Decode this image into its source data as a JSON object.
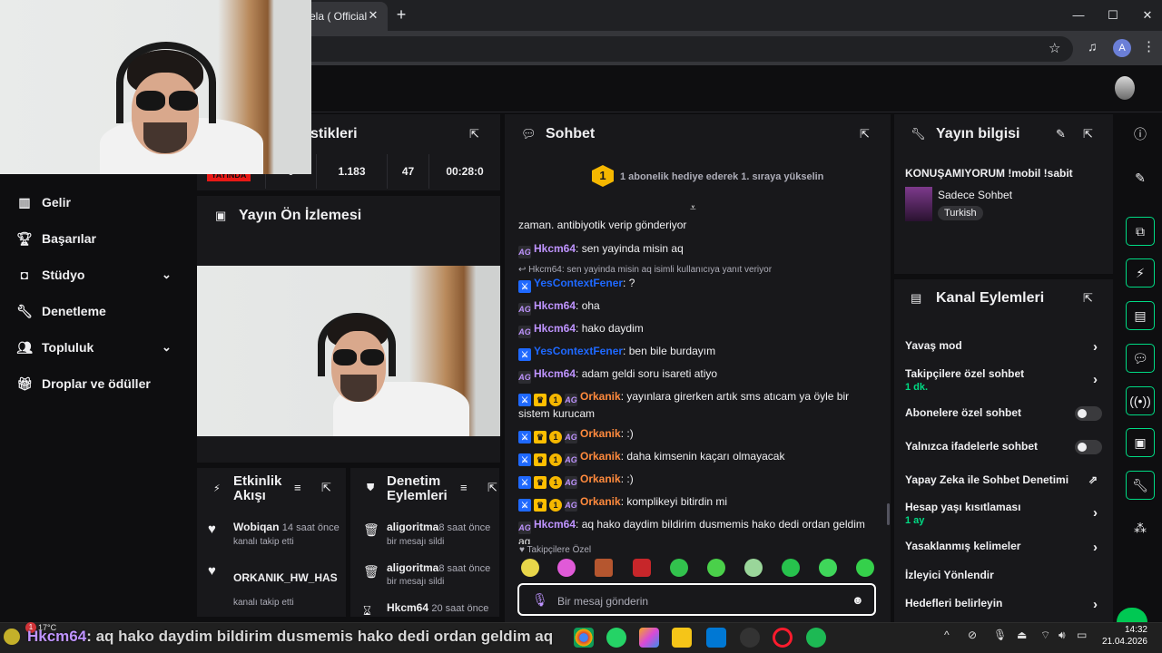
{
  "browser": {
    "tab_title": "ela ( Official",
    "new_tab": "+",
    "profile_initial": "A"
  },
  "nav": {
    "items": [
      {
        "label": "Gelir"
      },
      {
        "label": "Başarılar"
      },
      {
        "label": "Stüdyo"
      },
      {
        "label": "Denetleme"
      },
      {
        "label": "Topluluk"
      },
      {
        "label": "Droplar ve ödüller"
      }
    ]
  },
  "stats": {
    "title": "stikleri",
    "live_badge": "YAYINDA",
    "values": [
      "0",
      "1.183",
      "47",
      "00:28:0"
    ]
  },
  "preview": {
    "title": "Yayın Ön İzlemesi"
  },
  "activity": {
    "title": "Etkinlik Akışı",
    "events": [
      {
        "name": "Wobiqan",
        "time": "14 saat önce",
        "desc": "kanalı takip etti"
      },
      {
        "name": "ORKANIK_HW_HAS",
        "time": "",
        "desc": "kanalı takip etti"
      }
    ]
  },
  "modactions": {
    "title": "Denetim Eylemleri",
    "events": [
      {
        "name": "aligoritma",
        "time": "8 saat önce",
        "desc": "bir mesajı sildi"
      },
      {
        "name": "aligoritma",
        "time": "8 saat önce",
        "desc": "bir mesajı sildi"
      },
      {
        "name": "Hkcm64",
        "time": "20 saat önce",
        "desc": ""
      }
    ]
  },
  "chat": {
    "title": "Sohbet",
    "hype": {
      "rank": "1",
      "text": "1 abonelik hediye ederek 1. sıraya yükselin"
    },
    "messages": [
      {
        "user": "",
        "text": "zaman. antibiyotik verip gönderiyor"
      },
      {
        "user": "Hkcm64",
        "text": ": sen yayinda misin aq"
      },
      {
        "reply": "Hkcm64: sen yayinda misin aq isimli kullanıcıya yanıt veriyor"
      },
      {
        "user": "YesContextFener",
        "text": ": ?"
      },
      {
        "user": "Hkcm64",
        "text": ": oha"
      },
      {
        "user": "Hkcm64",
        "text": ": hako daydim"
      },
      {
        "user": "YesContextFener",
        "text": ": ben bile burdayım"
      },
      {
        "user": "Hkcm64",
        "text": ": adam geldi soru isareti atiyo"
      },
      {
        "user": "Orkanik",
        "text": ": yayınlara girerken artık sms atıcam ya öyle bir sistem kurucam"
      },
      {
        "user": "Orkanik",
        "text": ": :)"
      },
      {
        "user": "Orkanik",
        "text": ": daha kimsenin kaçarı olmayacak"
      },
      {
        "user": "Orkanik",
        "text": ": :)"
      },
      {
        "user": "Orkanik",
        "text": ": komplikeyi bitirdin mi"
      },
      {
        "user": "Hkcm64",
        "text": ": aq hako daydim bildirim dusmemis hako dedi ordan geldim aq"
      }
    ],
    "badge_text": {
      "ai": "AG",
      "gold": "1"
    },
    "followers_only_label": "Takipçilere Özel",
    "input_placeholder": "Bir mesaj gönderin"
  },
  "streaminfo": {
    "title": "Yayın bilgisi",
    "stream_title": "KONUŞAMIYORUM !mobil !sabit",
    "category": "Sadece Sohbet",
    "tag": "Turkish"
  },
  "channelactions": {
    "title": "Kanal Eylemleri",
    "items": [
      {
        "label": "Yavaş mod",
        "sub": ""
      },
      {
        "label": "Takipçilere özel sohbet",
        "sub": "1 dk."
      },
      {
        "label": "Abonelere özel sohbet",
        "sub": ""
      },
      {
        "label": "Yalnızca ifadelerle sohbet",
        "sub": ""
      },
      {
        "label": "Yapay Zeka ile Sohbet Denetimi",
        "sub": ""
      },
      {
        "label": "Hesap yaşı kısıtlaması",
        "sub": "1 ay"
      },
      {
        "label": "Yasaklanmış kelimeler",
        "sub": ""
      },
      {
        "label": "İzleyici Yönlendir",
        "sub": ""
      },
      {
        "label": "Hedefleri belirleyin",
        "sub": ""
      }
    ]
  },
  "taskbar": {
    "overlay_user": "Hkcm64",
    "overlay_text": ": aq hako daydim bildirim dusmemis hako dedi ordan geldim aq",
    "weather": "17°C",
    "notif_count": "1",
    "time": "14:32",
    "date": "21.04.2026"
  },
  "colors": {
    "twitch_purple": "#bf94ff",
    "mod_blue": "#1f69ff",
    "orange_user": "#ff8a3d",
    "green_sub": "#00db84",
    "live_red": "#e91916"
  }
}
